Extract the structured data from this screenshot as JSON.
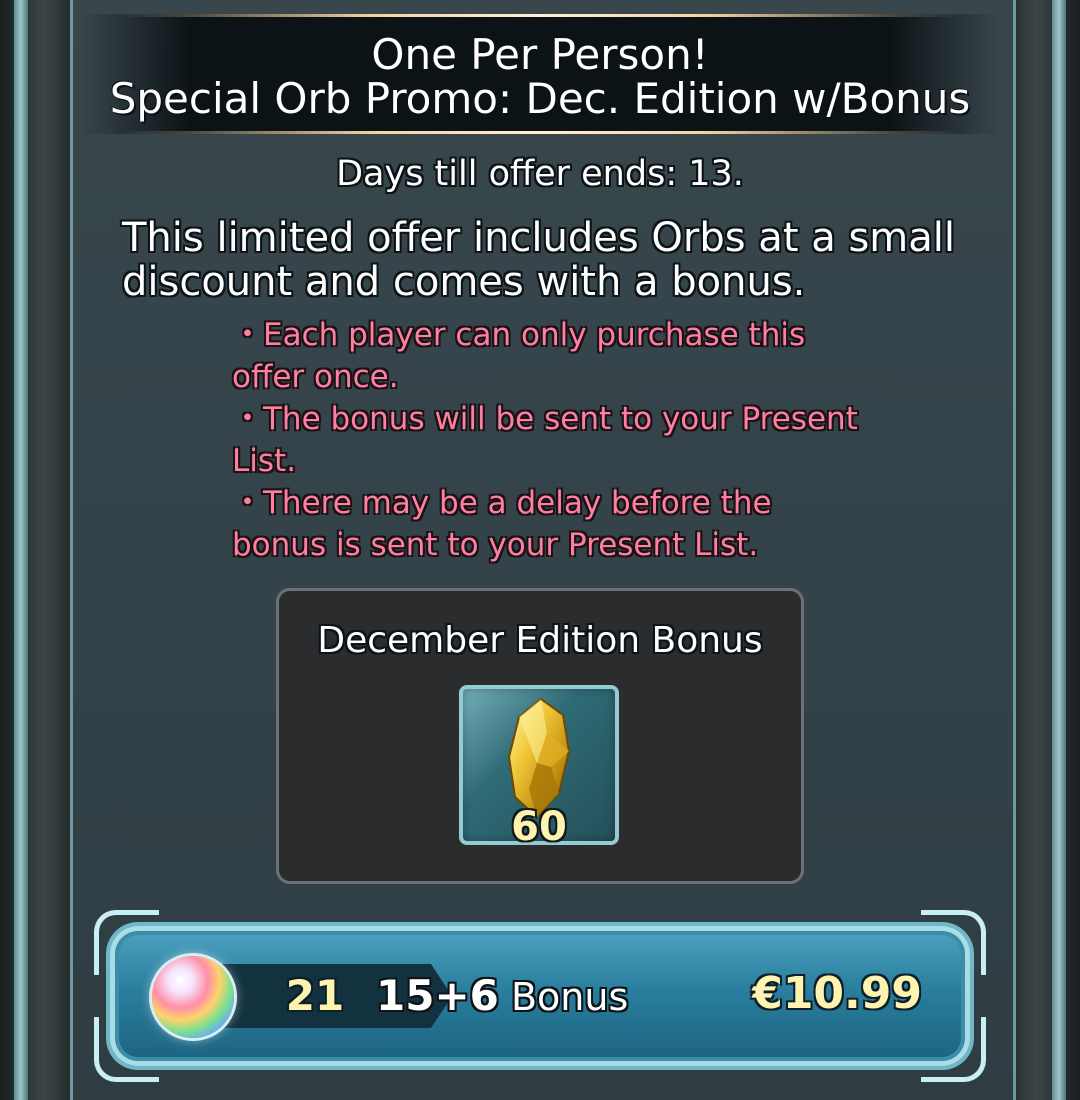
{
  "dialog": {
    "title_line1": "One Per Person!",
    "title_line2": "Special Orb Promo: Dec. Edition w/Bonus",
    "days_remaining": "Days till offer ends: 13.",
    "description": "This limited offer includes Orbs at a small discount and comes with a bonus.",
    "notes": [
      "・Each player can only purchase this offer once.",
      "・The bonus will be sent to your Present List.",
      "・There may be a delay before the bonus is sent to your Present List."
    ]
  },
  "bonus": {
    "title": "December Edition Bonus",
    "item_icon": "gold-crystal-icon",
    "item_count": "60"
  },
  "purchase": {
    "orb_icon": "rainbow-orb-icon",
    "orb_total": "21",
    "base_plus_bonus": "15+6",
    "bonus_label": "Bonus",
    "price": "€10.99"
  },
  "colors": {
    "note_text": "#ff7fa1",
    "accent_gold": "#fff3b0",
    "button_teal": "#2a7e9e"
  }
}
